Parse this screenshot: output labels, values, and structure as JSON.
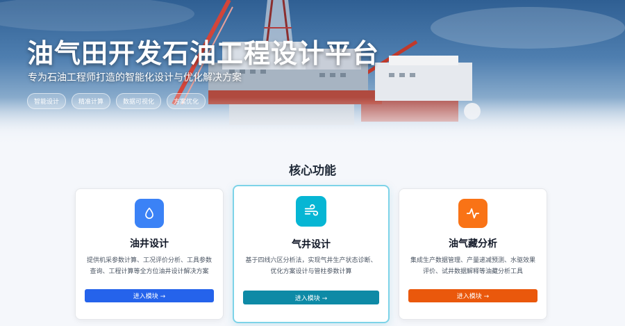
{
  "hero": {
    "title": "油气田开发石油工程设计平台",
    "subtitle": "专为石油工程师打造的智能化设计与优化解决方案",
    "background_image": "offshore-oil-platform-photo",
    "tags": [
      "智能设计",
      "精准计算",
      "数据可视化",
      "方案优化"
    ]
  },
  "section": {
    "title": "核心功能"
  },
  "cards": [
    {
      "icon": "droplet-icon",
      "icon_color": "#3b82f6",
      "title": "油井设计",
      "description": "提供机采参数计算、工况评价分析、工具参数查询、工程计算等全方位油井设计解决方案",
      "button_label": "进入模块 →",
      "button_color": "#2563eb",
      "active": false
    },
    {
      "icon": "wind-icon",
      "icon_color": "#06b6d4",
      "title": "气井设计",
      "description": "基于四线六区分析法，实现气井生产状态诊断、优化方案设计与管柱参数计算",
      "button_label": "进入模块 →",
      "button_color": "#0e8aa6",
      "active": true
    },
    {
      "icon": "activity-icon",
      "icon_color": "#f97316",
      "title": "油气藏分析",
      "description": "集成生产数据管理、产量递减预测、水驱效果评价、试井数据解释等油藏分析工具",
      "button_label": "进入模块 →",
      "button_color": "#ea580c",
      "active": false
    }
  ]
}
